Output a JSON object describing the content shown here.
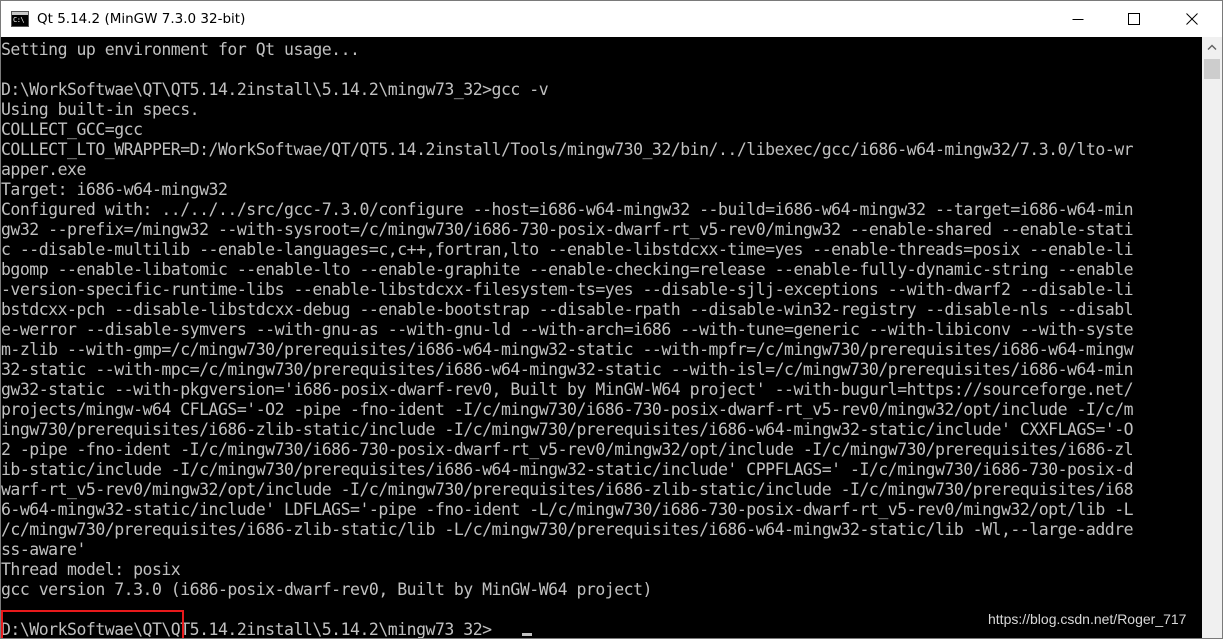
{
  "window": {
    "title": "Qt 5.14.2 (MinGW 7.3.0 32-bit)"
  },
  "console": {
    "lines": [
      "Setting up environment for Qt usage...",
      "",
      "D:\\WorkSoftwae\\QT\\QT5.14.2install\\5.14.2\\mingw73_32>gcc -v",
      "Using built-in specs.",
      "COLLECT_GCC=gcc",
      "COLLECT_LTO_WRAPPER=D:/WorkSoftwae/QT/QT5.14.2install/Tools/mingw730_32/bin/../libexec/gcc/i686-w64-mingw32/7.3.0/lto-wr",
      "apper.exe",
      "Target: i686-w64-mingw32",
      "Configured with: ../../../src/gcc-7.3.0/configure --host=i686-w64-mingw32 --build=i686-w64-mingw32 --target=i686-w64-min",
      "gw32 --prefix=/mingw32 --with-sysroot=/c/mingw730/i686-730-posix-dwarf-rt_v5-rev0/mingw32 --enable-shared --enable-stati",
      "c --disable-multilib --enable-languages=c,c++,fortran,lto --enable-libstdcxx-time=yes --enable-threads=posix --enable-li",
      "bgomp --enable-libatomic --enable-lto --enable-graphite --enable-checking=release --enable-fully-dynamic-string --enable",
      "-version-specific-runtime-libs --enable-libstdcxx-filesystem-ts=yes --disable-sjlj-exceptions --with-dwarf2 --disable-li",
      "bstdcxx-pch --disable-libstdcxx-debug --enable-bootstrap --disable-rpath --disable-win32-registry --disable-nls --disabl",
      "e-werror --disable-symvers --with-gnu-as --with-gnu-ld --with-arch=i686 --with-tune=generic --with-libiconv --with-syste",
      "m-zlib --with-gmp=/c/mingw730/prerequisites/i686-w64-mingw32-static --with-mpfr=/c/mingw730/prerequisites/i686-w64-mingw",
      "32-static --with-mpc=/c/mingw730/prerequisites/i686-w64-mingw32-static --with-isl=/c/mingw730/prerequisites/i686-w64-min",
      "gw32-static --with-pkgversion='i686-posix-dwarf-rev0, Built by MinGW-W64 project' --with-bugurl=https://sourceforge.net/",
      "projects/mingw-w64 CFLAGS='-O2 -pipe -fno-ident -I/c/mingw730/i686-730-posix-dwarf-rt_v5-rev0/mingw32/opt/include -I/c/m",
      "ingw730/prerequisites/i686-zlib-static/include -I/c/mingw730/prerequisites/i686-w64-mingw32-static/include' CXXFLAGS='-O",
      "2 -pipe -fno-ident -I/c/mingw730/i686-730-posix-dwarf-rt_v5-rev0/mingw32/opt/include -I/c/mingw730/prerequisites/i686-zl",
      "ib-static/include -I/c/mingw730/prerequisites/i686-w64-mingw32-static/include' CPPFLAGS=' -I/c/mingw730/i686-730-posix-d",
      "warf-rt_v5-rev0/mingw32/opt/include -I/c/mingw730/prerequisites/i686-zlib-static/include -I/c/mingw730/prerequisites/i68",
      "6-w64-mingw32-static/include' LDFLAGS='-pipe -fno-ident -L/c/mingw730/i686-730-posix-dwarf-rt_v5-rev0/mingw32/opt/lib -L",
      "/c/mingw730/prerequisites/i686-zlib-static/lib -L/c/mingw730/prerequisites/i686-w64-mingw32-static/lib -Wl,--large-addre",
      "ss-aware'",
      "Thread model: posix",
      "gcc version 7.3.0 (i686-posix-dwarf-rev0, Built by MinGW-W64 project)",
      "",
      "D:\\WorkSoftwae\\QT\\QT5.14.2install\\5.14.2\\mingw73_32>"
    ]
  },
  "watermark": "https://blog.csdn.net/Roger_717",
  "colors": {
    "console_bg": "#000000",
    "console_text": "#c0c0c0",
    "highlight_border": "#e8191b",
    "titlebar_bg": "#ffffff"
  },
  "icons": {
    "app": "console-app-icon",
    "minimize": "minimize-icon",
    "maximize": "maximize-icon",
    "close": "close-icon",
    "scroll_up": "scroll-up-arrow-icon"
  }
}
